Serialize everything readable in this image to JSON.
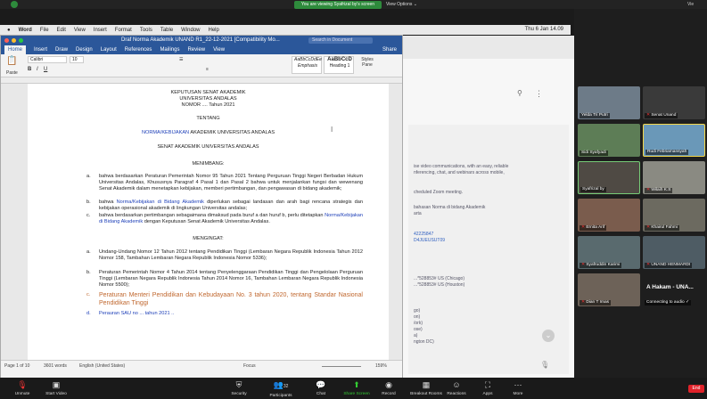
{
  "zoom_top": {
    "share_notice": "You are viewing Syafrizal by's screen",
    "view_options": "View Options ⌄",
    "view": "Vie"
  },
  "menubar": {
    "app": "Word",
    "items": [
      "File",
      "Edit",
      "View",
      "Insert",
      "Format",
      "Tools",
      "Table",
      "Window",
      "Help"
    ],
    "clock": "Thu 6 Jan 14.09"
  },
  "word": {
    "title": "Draf Norma Akademik UNAND R1_22-12-2021 [Compatibility Mo...",
    "search_placeholder": "Search in Document",
    "tabs": [
      "Home",
      "Insert",
      "Draw",
      "Design",
      "Layout",
      "References",
      "Mailings",
      "Review",
      "View"
    ],
    "share": "Share",
    "font": "Calibri",
    "size": "10",
    "style1": "AaBbCcDdEe",
    "style1_label": "Emphasis",
    "style2": "AaBbCcD",
    "style2_label": "Heading 1",
    "styles_pane": "Styles Pane",
    "paste": "Paste",
    "status": {
      "page": "Page 1 of 10",
      "words": "3601 words",
      "lang": "English (United States)",
      "focus": "Focus",
      "zoom": "159%"
    }
  },
  "doc": {
    "h1": "KEPUTUSAN SENAT AKADEMIK",
    "h2": "UNIVERSITAS ANDALAS",
    "h3": "NOMOR .... Tahun 2021",
    "tentang": "TENTANG",
    "norma_blue": "NORMA/KEBIJAKAN",
    "norma_rest": " AKADEMIK UNIVERSITAS ANDALAS",
    "senat": "SENAT AKADEMIK UNIVERSITAS ANDALAS",
    "menimbang": "MENIMBANG:",
    "a_label": "a.",
    "a_text": "bahwa berdasarkan Peraturan Pemerintah Nomor 95 Tahun 2021 Tentang Perguruan Tinggi Negeri Berbadan Hukum Universitas Andalas, Khususnya Paragraf 4 Pasal 1 dan Pasal 2  bahwa untuk menjalankan fungsi dan wewenang Senat Akademik dalam menetapkan kebijakan, memberi pertimbangan, dan pengawasan di bidang akademik;",
    "b_label": "b.",
    "b_pre": "bahwa ",
    "b_blue": "Norma/Kebijakan di Bidang Akademik",
    "b_post": " diperlukan sebagai landasan dan arah bagi rencana strategis dan kebijakan operasional akademik di lingkungan Universitas andalas;",
    "c_label": "c.",
    "c_pre": "bahwa berdasarkan pertimbangan sebagaimana dimaksud pada buruf a dan huruf b, perlu ditetapkan ",
    "c_blue": "Norma/Kebijakan di Bidang Akademik",
    "c_post": " dengan Keputusan Senat Akademik Universitas Andalas.",
    "mengingat": "MENGINGAT:",
    "m_a_label": "a.",
    "m_a": "Undang-Undang Nomor 12 Tahun 2012 tentang Pendidikan Tinggi (Lembaran Negara Republik Indonesia Tahun 2012 Nomor 158, Tambahan Lembaran Negara Republik Indonesia Nomor 5336);",
    "m_b_label": "b.",
    "m_b": "Peraturan Pemerintah Nomor 4 Tahun 2014 tentang Penyelenggaraan Pendidikan Tinggi dan Pengelolaan Perguruan Tinggi (Lembaran Negara Republik Indonesia Tahun 2014 Nomor 16, Tambahan Lembaran Negara Republik Indonesia Nomor 5500);",
    "m_c_label": "c.",
    "m_c": "Peraturan Menteri Pendidikan dan Kebudayaan No. 3 tahun 2020, tentang Standar Nasional Pendidikan Tinggi",
    "m_d_label": "d.",
    "m_d": "Perauran SAU no ... tahun 2021 .."
  },
  "bg_zoom": {
    "l1": "ise video communications, with an easy, reliable",
    "l2": "nferencing, chat, and webinars across mobile,",
    "l3": "cheduled Zoom meeting.",
    "l4": "bahasan Norma di bidang Akademik",
    "l5": "arta",
    "l6": "42225847",
    "l7": "D4JUEUSUT09",
    "l8": "...*528853# US (Chicago)",
    "l9": "...*528853# US (Houston)",
    "l10": "go)",
    "l11": "on)",
    "l12": "/ork)",
    "l13": "ose)",
    "l14": "a)",
    "l15": "ngton DC)"
  },
  "participants": [
    {
      "name": "Yelda Tri Putri",
      "muted": false
    },
    {
      "name": "Senat Unand",
      "muted": true
    },
    {
      "name": "Sidi Syafyadi",
      "muted": false
    },
    {
      "name": "Rudi Febriamansyah",
      "muted": false
    },
    {
      "name": "Syafrizal by",
      "muted": false
    },
    {
      "name": "Wilaih K.S",
      "muted": true
    },
    {
      "name": "Ernita Arif",
      "muted": true
    },
    {
      "name": "Khairul Fahmi",
      "muted": true
    },
    {
      "name": "Syafruddin Karimi",
      "muted": true
    },
    {
      "name": "UNAND HENMARDI",
      "muted": true
    },
    {
      "name": "Dian T Imas",
      "muted": true
    },
    {
      "name": "A Hakam - UNA...",
      "muted": false,
      "sub": "Connecting to audio ✓"
    }
  ],
  "toolbar": {
    "unmute": "Unmute",
    "start_video": "Start Video",
    "security": "Security",
    "participants": "Participants",
    "participants_count": "32",
    "chat": "Chat",
    "share": "Share Screen",
    "record": "Record",
    "breakout": "Breakout Rooms",
    "reactions": "Reactions",
    "apps": "Apps",
    "more": "More",
    "end": "End"
  }
}
